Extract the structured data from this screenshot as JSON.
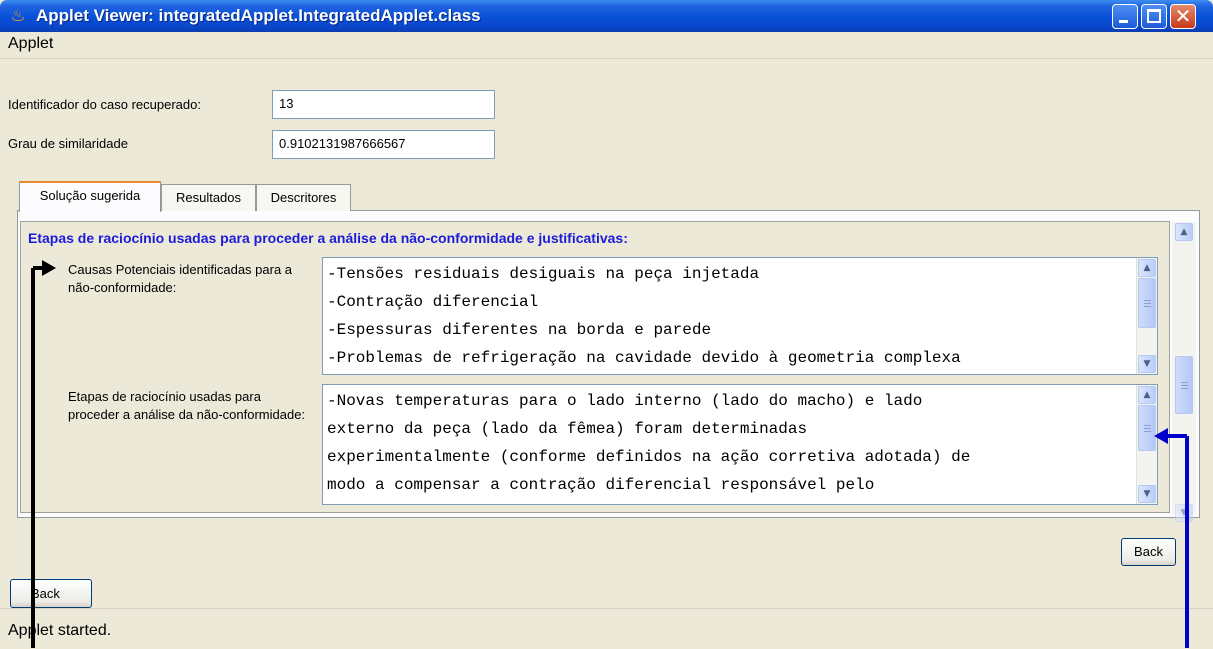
{
  "window": {
    "title": "Applet Viewer: integratedApplet.IntegratedApplet.class",
    "minimize_glyph": "_",
    "close_glyph": "✕"
  },
  "menubar": {
    "menus": [
      "Applet"
    ]
  },
  "form": {
    "case_id_label": "Identificador do caso recuperado:",
    "case_id_value": "13",
    "similarity_label": "Grau de similaridade",
    "similarity_value": "0.9102131987666567"
  },
  "tabs": [
    {
      "label": "Solução sugerida",
      "selected": true
    },
    {
      "label": "Resultados",
      "selected": false
    },
    {
      "label": "Descritores",
      "selected": false
    }
  ],
  "panel": {
    "heading": "Etapas de raciocínio usadas para proceder a análise da não-conformidade e justificativas:",
    "causes_label": "Causas Potenciais identificadas para a não-conformidade:",
    "causes_lines": [
      "-Tensões residuais desiguais na peça injetada",
      "-Contração diferencial",
      "-Espessuras diferentes na borda e parede",
      "-Problemas de refrigeração na cavidade devido à geometria complexa"
    ],
    "reasoning_label": "Etapas de raciocínio usadas para proceder a análise da não-conformidade:",
    "reasoning_lines": [
      "-Novas temperaturas para o lado interno (lado do macho) e lado",
      "externo da peça (lado da fêmea) foram determinadas",
      "experimentalmente (conforme definidos na ação corretiva adotada) de",
      "modo a compensar a contração diferencial responsável pelo"
    ]
  },
  "buttons": {
    "back_right": "Back",
    "back_left": "Back"
  },
  "statusbar": {
    "text": "Applet started."
  },
  "icons": {
    "java": "java-cup-icon",
    "scroll_up": "▲",
    "scroll_down": "▼"
  },
  "colors": {
    "title_bar": "#0a4fd6",
    "heading_text": "#1c1cd8",
    "annotation_black": "#000000",
    "annotation_blue": "#0000cc"
  }
}
